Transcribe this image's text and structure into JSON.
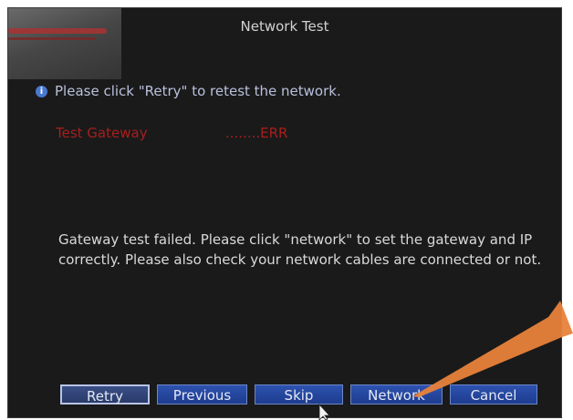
{
  "window": {
    "title": "Network Test"
  },
  "hint": {
    "icon": "info-icon",
    "text": "Please click \"Retry\" to retest the network."
  },
  "test_result": {
    "label": "Test Gateway",
    "status": "........ERR",
    "status_color": "#a81e1e"
  },
  "message": "Gateway test failed. Please click \"network\" to set the gateway and IP correctly. Please also check your network cables are connected or not.",
  "buttons": {
    "retry": "Retry",
    "previous": "Previous",
    "skip": "Skip",
    "network": "Network",
    "cancel": "Cancel"
  },
  "colors": {
    "background": "#1a1a1a",
    "button": "#2d52b0",
    "annotation_arrow": "#e8823a"
  }
}
